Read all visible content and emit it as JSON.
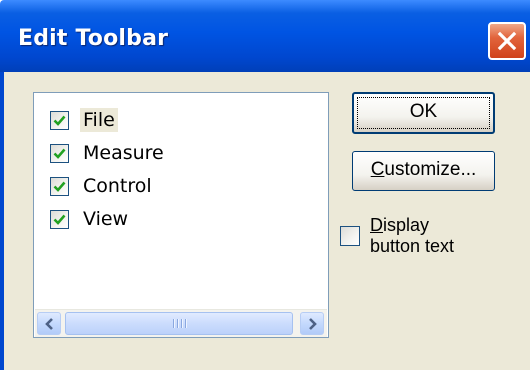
{
  "window": {
    "title": "Edit Toolbar"
  },
  "toolbar_list": {
    "items": [
      {
        "label": "File",
        "checked": true,
        "selected": true
      },
      {
        "label": "Measure",
        "checked": true,
        "selected": false
      },
      {
        "label": "Control",
        "checked": true,
        "selected": false
      },
      {
        "label": "View",
        "checked": true,
        "selected": false
      }
    ],
    "scrollbar": {
      "left_arrow_icon": "chevron-left-icon",
      "right_arrow_icon": "chevron-right-icon",
      "thumb_grip_icon": "grip-icon"
    }
  },
  "buttons": {
    "ok_label": "OK",
    "customize_label": "Customize..."
  },
  "options": {
    "display_button_text": {
      "line1": "Display",
      "line2": "button text",
      "checked": false
    }
  },
  "colors": {
    "titlebar": "#0054e3",
    "client_background": "#ece9d8",
    "close_button": "#d0421a",
    "checkmark": "#21a121"
  }
}
